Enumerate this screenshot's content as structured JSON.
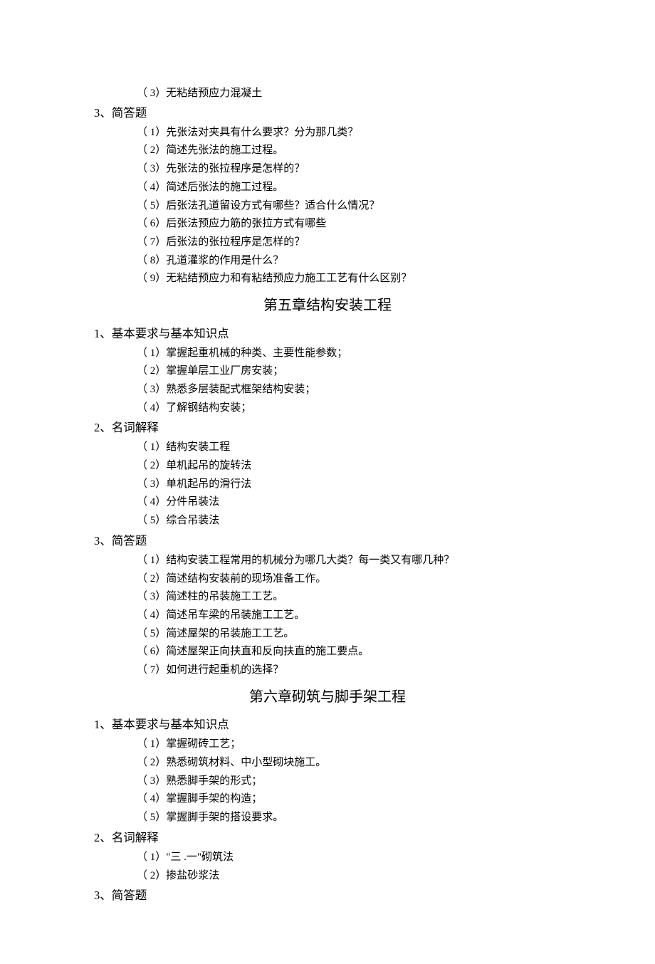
{
  "s0": {
    "items": [
      "（ 3）无粘结预应力混凝土"
    ]
  },
  "s1": {
    "title": "3、简答题",
    "items": [
      "（ 1）先张法对夹具有什么要求？分为那几类？",
      "（ 2）简述先张法的施工过程。",
      "（ 3）先张法的张拉程序是怎样的？",
      "（ 4）简述后张法的施工过程。",
      "（ 5）后张法孔道留设方式有哪些？适合什么情况？",
      "（ 6）后张法预应力筋的张拉方式有哪些",
      "（ 7）后张法的张拉程序是怎样的？",
      "（ 8）孔道灌浆的作用是什么？",
      "（ 9）无粘结预应力和有粘结预应力施工工艺有什么区别？"
    ]
  },
  "ch5": {
    "title": "第五章结构安装工程"
  },
  "s2": {
    "title": "1、基本要求与基本知识点",
    "items": [
      "（ 1）掌握起重机械的种类、主要性能参数；",
      "（ 2）掌握单层工业厂房安装；",
      "（ 3）熟悉多层装配式框架结构安装；",
      "（ 4）了解钢结构安装；"
    ]
  },
  "s3": {
    "title": "2、名词解释",
    "items": [
      "（ 1）结构安装工程",
      "（ 2）单机起吊的旋转法",
      "（ 3）单机起吊的滑行法",
      "（ 4）分件吊装法",
      "（ 5）综合吊装法"
    ]
  },
  "s4": {
    "title": "3、简答题",
    "items": [
      "（ 1）结构安装工程常用的机械分为哪几大类？每一类又有哪几种？",
      "（ 2）简述结构安装前的现场准备工作。",
      "（ 3）简述柱的吊装施工工艺。",
      "（ 4）简述吊车梁的吊装施工工艺。",
      "（ 5）简述屋架的吊装施工工艺。",
      "（ 6）简述屋架正向扶直和反向扶直的施工要点。",
      "（ 7）如何进行起重机的选择？"
    ]
  },
  "ch6": {
    "title": "第六章砌筑与脚手架工程"
  },
  "s5": {
    "title": "1、基本要求与基本知识点",
    "items": [
      "（ 1）掌握砌砖工艺；",
      "（ 2）熟悉砌筑材料、中小型砌块施工。",
      "（ 3）熟悉脚手架的形式；",
      "（ 4）掌握脚手架的构造；",
      "（ 5）掌握脚手架的搭设要求。"
    ]
  },
  "s6": {
    "title": "2、名词解释",
    "items": [
      "（ 1）\"三 .一\"砌筑法",
      "（ 2）掺盐砂浆法"
    ]
  },
  "s7": {
    "title": "3、简答题"
  }
}
